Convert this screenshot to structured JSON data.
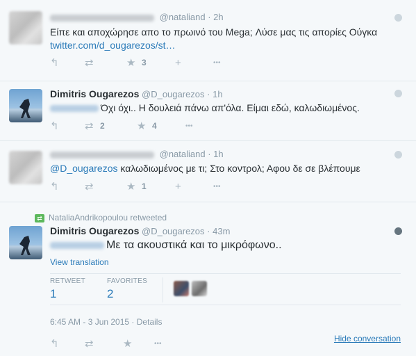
{
  "icons": {
    "reply": "↰",
    "retweet": "⇄",
    "favorite": "★",
    "follow": "+",
    "more": "•••"
  },
  "tweets": [
    {
      "handle": "@nataliand",
      "time": "2h",
      "text": "Είπε και αποχώρησε απο το πρωινό του Mega; Λύσε μας τις απορίες Ούγκα",
      "link": "twitter.com/d_ougarezos/st…",
      "favorites": "3"
    },
    {
      "name": "Dimitris Ougarezos",
      "handle": "@D_ougarezos",
      "time": "1h",
      "text": "Όχι όχι.. Η δουλειά πάνω απ'όλα. Είμαι εδώ, καλωδιωμένος.",
      "retweets": "2",
      "favorites": "4"
    },
    {
      "handle": "@nataliand",
      "time": "1h",
      "mention": "@D_ougarezos",
      "text": "καλωδιωμένος με τι; Στο κοντρολ; Αφου δε σε βλέπουμε",
      "favorites": "1"
    },
    {
      "retweet_context": "NataliaAndrikopoulou retweeted",
      "name": "Dimitris Ougarezos",
      "handle": "@D_ougarezos",
      "time": "43m",
      "text": "Με τα ακουστικά και το μικρόφωνο..",
      "view_translation": "View translation",
      "stats": {
        "retweet_label": "RETWEET",
        "retweet_count": "1",
        "favorites_label": "FAVORITES",
        "favorites_count": "2"
      },
      "meta": {
        "datetime": "6:45 AM - 3 Jun 2015",
        "separator": "·",
        "details": "Details"
      },
      "hide_conversation": "Hide conversation"
    }
  ]
}
